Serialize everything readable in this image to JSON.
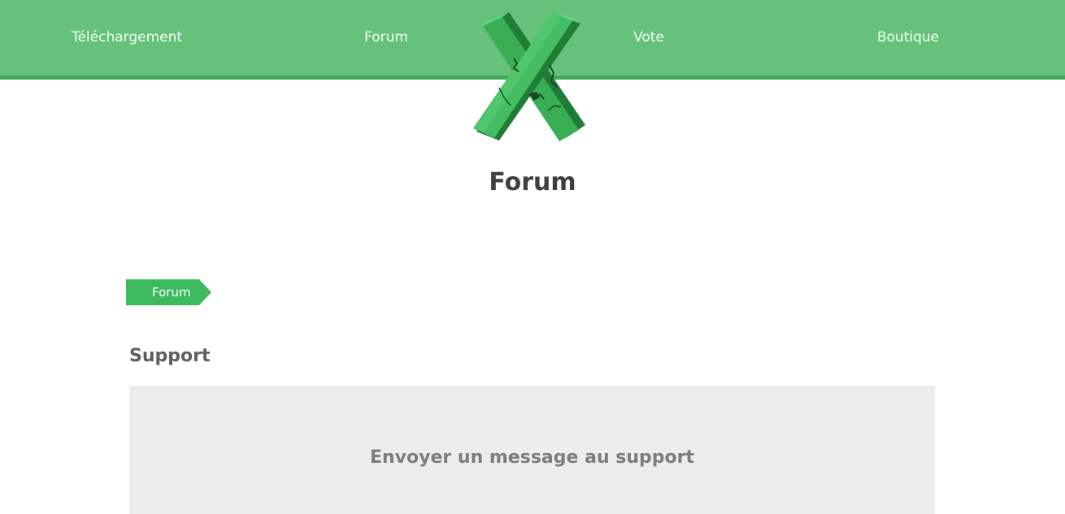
{
  "nav": {
    "items": [
      {
        "label": "Téléchargement"
      },
      {
        "label": "Forum"
      },
      {
        "label": "Vote"
      },
      {
        "label": "Boutique"
      }
    ]
  },
  "logo": {
    "icon": "green-x-logo-icon",
    "colors": {
      "light": "#4cc46a",
      "mid": "#33a64f",
      "dark": "#1f7d36",
      "crack": "#1a4a25"
    }
  },
  "colors": {
    "nav_bg": "#66c27a",
    "nav_border": "#43a95a",
    "accent": "#3dba5e",
    "panel_bg": "#ededed"
  },
  "page": {
    "title": "Forum"
  },
  "breadcrumb": {
    "items": [
      {
        "label": "Forum"
      }
    ]
  },
  "section": {
    "title": "Support",
    "link_label": "Envoyer un message au support"
  }
}
